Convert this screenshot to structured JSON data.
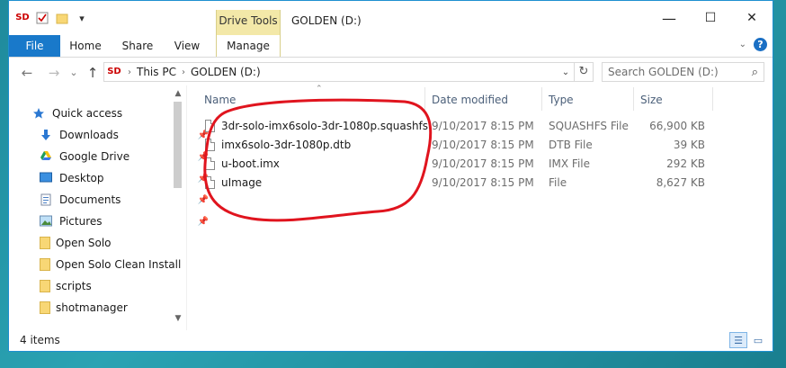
{
  "window": {
    "title": "GOLDEN (D:)",
    "context_tab": "Drive Tools",
    "minimize": "—",
    "maximize": "☐",
    "close": "✕"
  },
  "qat": {
    "logo_text": "SD",
    "dropdown": "▾"
  },
  "ribbon": {
    "tabs": [
      {
        "label": "File"
      },
      {
        "label": "Home"
      },
      {
        "label": "Share"
      },
      {
        "label": "View"
      },
      {
        "label": "Manage"
      }
    ],
    "help": "?"
  },
  "address": {
    "back": "←",
    "forward": "→",
    "recent": "⌄",
    "up": "↑",
    "breadcrumbs": [
      "This PC",
      "GOLDEN (D:)"
    ],
    "search_placeholder": "Search GOLDEN (D:)"
  },
  "sidebar": {
    "items": [
      {
        "label": "Quick access",
        "icon": "star-icon",
        "pinned": false
      },
      {
        "label": "Downloads",
        "icon": "download-arrow-icon",
        "pinned": true
      },
      {
        "label": "Google Drive",
        "icon": "google-drive-icon",
        "pinned": true
      },
      {
        "label": "Desktop",
        "icon": "desktop-icon",
        "pinned": true
      },
      {
        "label": "Documents",
        "icon": "documents-icon",
        "pinned": true
      },
      {
        "label": "Pictures",
        "icon": "pictures-icon",
        "pinned": true
      },
      {
        "label": "Open Solo",
        "icon": "folder-icon",
        "pinned": false
      },
      {
        "label": "Open Solo Clean Install",
        "icon": "folder-icon",
        "pinned": false
      },
      {
        "label": "scripts",
        "icon": "folder-icon",
        "pinned": false
      },
      {
        "label": "shotmanager",
        "icon": "folder-icon",
        "pinned": false
      }
    ]
  },
  "file_list": {
    "columns": [
      "Name",
      "Date modified",
      "Type",
      "Size"
    ],
    "rows": [
      {
        "name": "3dr-solo-imx6solo-3dr-1080p.squashfs",
        "date": "9/10/2017 8:15 PM",
        "type": "SQUASHFS File",
        "size": "66,900 KB"
      },
      {
        "name": "imx6solo-3dr-1080p.dtb",
        "date": "9/10/2017 8:15 PM",
        "type": "DTB File",
        "size": "39 KB"
      },
      {
        "name": "u-boot.imx",
        "date": "9/10/2017 8:15 PM",
        "type": "IMX File",
        "size": "292 KB"
      },
      {
        "name": "uImage",
        "date": "9/10/2017 8:15 PM",
        "type": "File",
        "size": "8,627 KB"
      }
    ]
  },
  "status": {
    "item_count": "4 items"
  },
  "colors": {
    "file_tab": "#1979ca",
    "drive_tools_tab": "#f3e8a8",
    "annotation": "#e0141e"
  }
}
